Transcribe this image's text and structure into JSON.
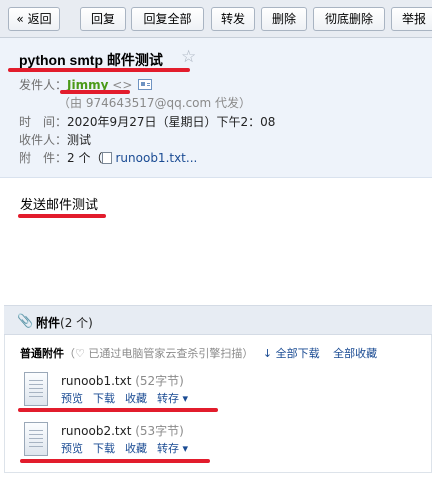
{
  "toolbar": {
    "back": "« 返回",
    "reply": "回复",
    "reply_all": "回复全部",
    "forward": "转发",
    "delete": "删除",
    "delete_forever": "彻底删除",
    "report": "举报"
  },
  "mail": {
    "subject": "python smtp 邮件测试",
    "star_icon": "☆",
    "from_label": "发件人：",
    "from_name": "Jimmy",
    "from_brackets": "<>",
    "on_behalf": "（由 974643517@qq.com 代发）",
    "time_label": "时　间：",
    "time_value": "2020年9月27日（星期日）下午2：08",
    "to_label": "收件人：",
    "to_value": "测试",
    "attach_label": "附　件：",
    "attach_count": "2 个",
    "attach_paren_open": "（",
    "attach_preview": "runoob1.txt..."
  },
  "body": {
    "text": "发送邮件测试"
  },
  "attachments": {
    "title_bold": "附件",
    "title_count": "(2 个)",
    "section_label": "普通附件",
    "scan_note": "（♡ 已通过电脑管家云查杀引擎扫描）",
    "download_all": "↓ 全部下载",
    "collect_all": "全部收藏",
    "files": [
      {
        "name": "runoob1.txt",
        "size": "(52字节)",
        "preview": "预览",
        "download": "下载",
        "collect": "收藏",
        "save": "转存 ▾"
      },
      {
        "name": "runoob2.txt",
        "size": "(53字节)",
        "preview": "预览",
        "download": "下载",
        "collect": "收藏",
        "save": "转存 ▾"
      }
    ]
  },
  "annotations": {
    "underline_color": "#e21c2c"
  }
}
